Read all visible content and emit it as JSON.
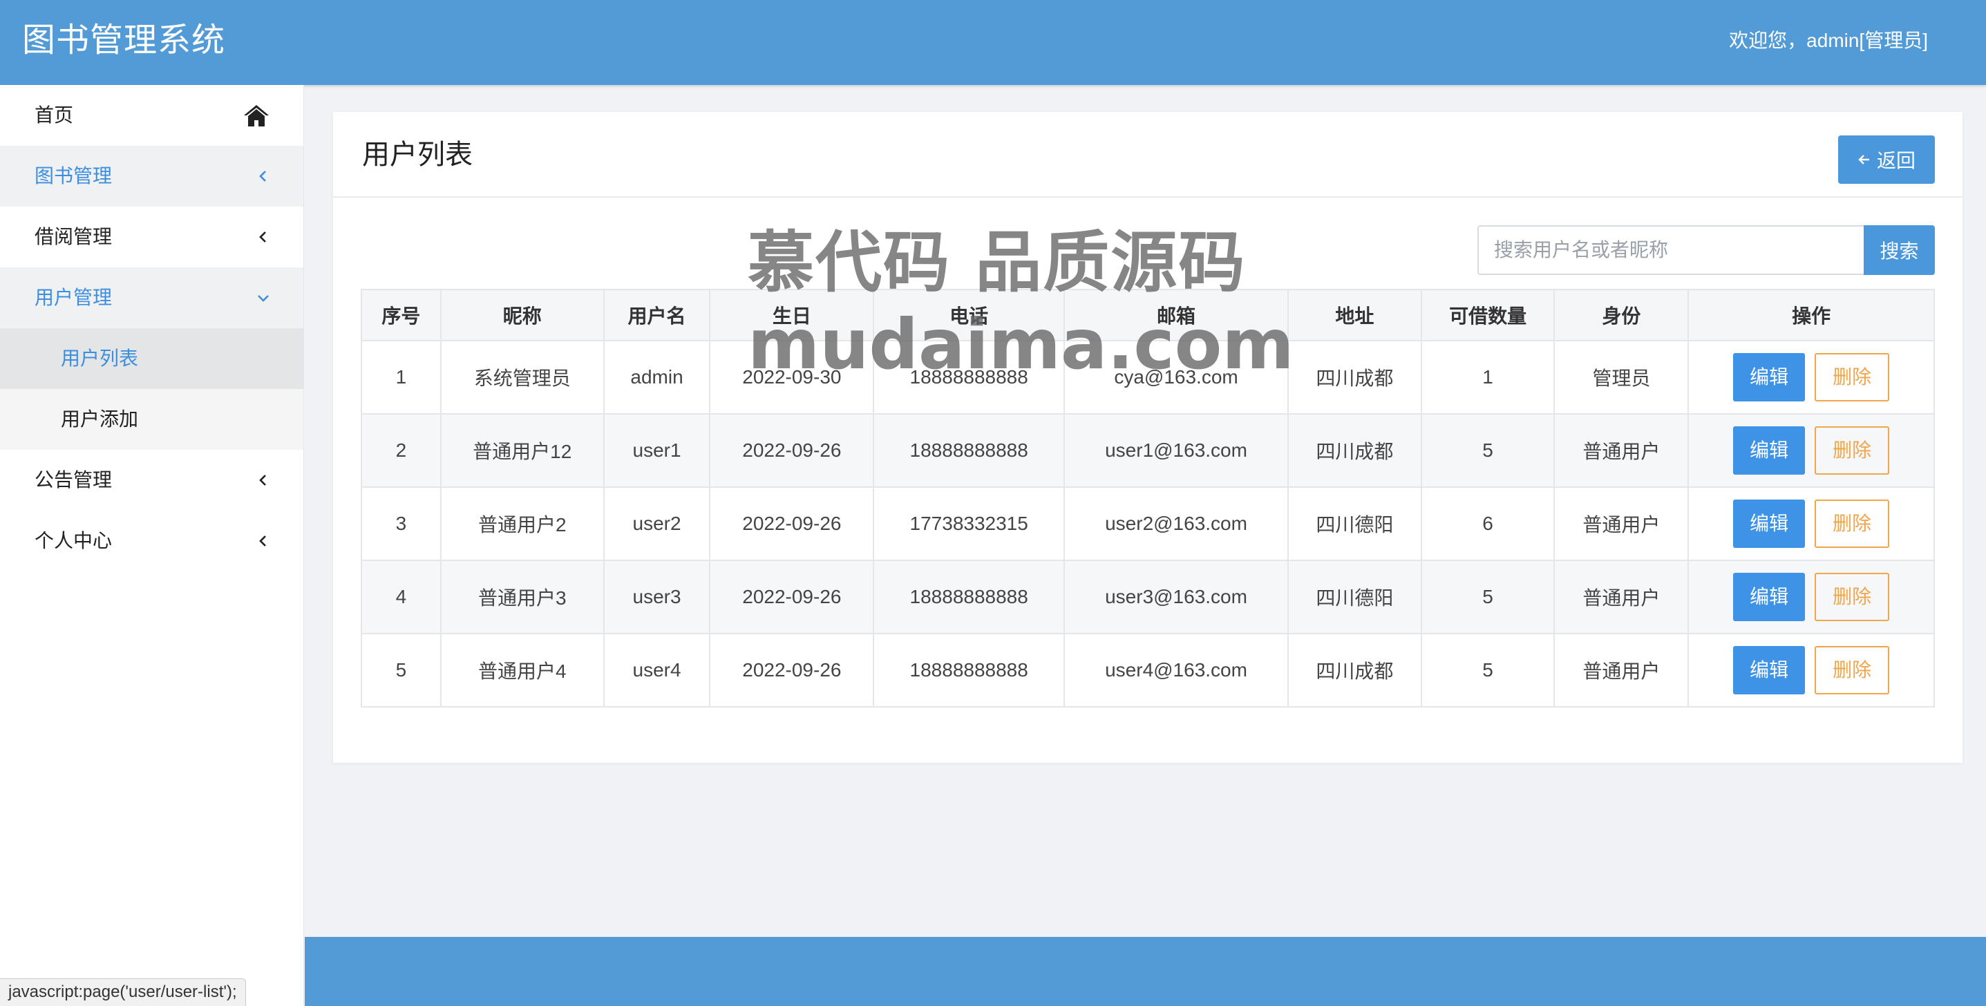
{
  "header": {
    "app_title": "图书管理系统",
    "welcome": "欢迎您，admin[管理员]"
  },
  "sidebar": {
    "items": [
      {
        "label": "首页",
        "icon": "home-icon"
      },
      {
        "label": "图书管理",
        "icon": "chevron-left-icon"
      },
      {
        "label": "借阅管理",
        "icon": "chevron-left-icon"
      },
      {
        "label": "用户管理",
        "icon": "chevron-down-icon"
      },
      {
        "label": "用户列表"
      },
      {
        "label": "用户添加"
      },
      {
        "label": "公告管理",
        "icon": "chevron-left-icon"
      },
      {
        "label": "个人中心",
        "icon": "chevron-left-icon"
      }
    ]
  },
  "main": {
    "title": "用户列表",
    "back_label": "返回",
    "search": {
      "placeholder": "搜索用户名或者昵称",
      "value": "",
      "button": "搜索"
    },
    "table": {
      "headers": [
        "序号",
        "昵称",
        "用户名",
        "生日",
        "电话",
        "邮箱",
        "地址",
        "可借数量",
        "身份",
        "操作"
      ],
      "edit_label": "编辑",
      "delete_label": "删除",
      "rows": [
        [
          "1",
          "系统管理员",
          "admin",
          "2022-09-30",
          "18888888888",
          "cya@163.com",
          "四川成都",
          "1",
          "管理员"
        ],
        [
          "2",
          "普通用户12",
          "user1",
          "2022-09-26",
          "18888888888",
          "user1@163.com",
          "四川成都",
          "5",
          "普通用户"
        ],
        [
          "3",
          "普通用户2",
          "user2",
          "2022-09-26",
          "17738332315",
          "user2@163.com",
          "四川德阳",
          "6",
          "普通用户"
        ],
        [
          "4",
          "普通用户3",
          "user3",
          "2022-09-26",
          "18888888888",
          "user3@163.com",
          "四川德阳",
          "5",
          "普通用户"
        ],
        [
          "5",
          "普通用户4",
          "user4",
          "2022-09-26",
          "18888888888",
          "user4@163.com",
          "四川成都",
          "5",
          "普通用户"
        ]
      ]
    }
  },
  "watermark": {
    "line1": "慕代码 品质源码",
    "line2": "mudaima.com"
  },
  "status_bar": {
    "url": "javascript:page('user/user-list');"
  },
  "colors": {
    "primary": "#539bd6",
    "button": "#4a97dc",
    "active_text": "#3c8fe0",
    "delete": "#f0a64a"
  }
}
